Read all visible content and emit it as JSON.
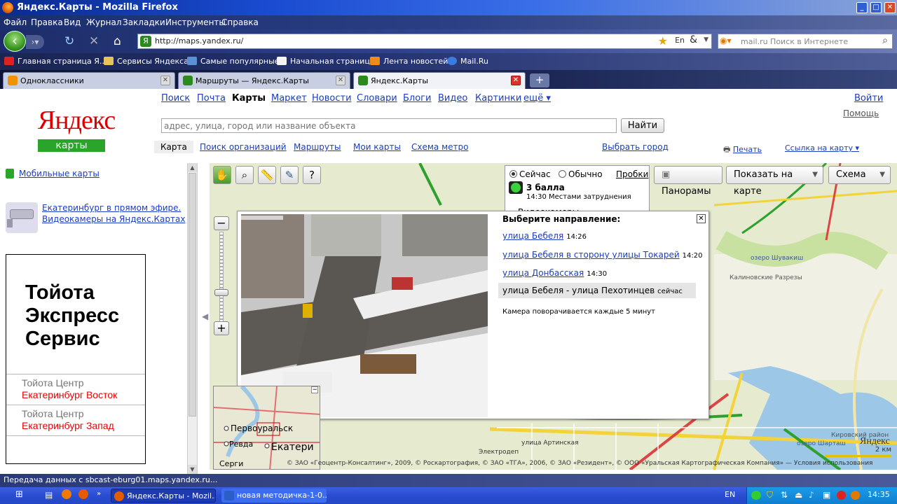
{
  "window": {
    "title": "Яндекс.Карты - Mozilla Firefox",
    "minimize": "_",
    "maximize": "□",
    "close": "✕"
  },
  "menu": [
    "Файл",
    "Правка",
    "Вид",
    "Журнал",
    "Закладки",
    "Инструменты",
    "Справка"
  ],
  "nav": {
    "url": "http://maps.yandex.ru/",
    "search_placeholder": "mail.ru Поиск в Интернете",
    "back_icon": "back-arrow-icon",
    "reload_icon": "reload-icon"
  },
  "bookmarks": [
    "Главная страница Я...",
    "Сервисы Яндекса",
    "Самые популярные",
    "Начальная страница",
    "Лента новостей",
    "Mail.Ru"
  ],
  "tabs": [
    {
      "label": "Одноклассники",
      "active": false
    },
    {
      "label": "Маршруты — Яндекс.Карты",
      "active": false
    },
    {
      "label": "Яндекс.Карты",
      "active": true
    }
  ],
  "header": {
    "logo": "Яндекс",
    "logo_sub": "карты",
    "services": [
      "Поиск",
      "Почта",
      "Карты",
      "Маркет",
      "Новости",
      "Словари",
      "Блоги",
      "Видео",
      "Картинки",
      "ещё ▾"
    ],
    "login": "Войти",
    "help": "Помощь",
    "search_placeholder": "адрес, улица, город или название объекта",
    "search_button": "Найти",
    "subtabs": [
      "Карта",
      "Поиск организаций",
      "Маршруты",
      "Мои карты",
      "Схема метро"
    ],
    "choose_city": "Выбрать город",
    "print": "Печать",
    "link_to_map": "Ссылка на карту ▾"
  },
  "sidebar": {
    "mobile": "Мобильные карты",
    "promo_line1": "Екатеринбург в прямом эфире.",
    "promo_line2": "Видеокамеры на Яндекс.Картах",
    "ad_big": [
      "Тойота",
      "Экспресс",
      "Сервис"
    ],
    "ad_rows": [
      {
        "a": "Тойота Центр",
        "b": "Екатеринбург Восток"
      },
      {
        "a": "Тойота Центр",
        "b": "Екатеринбург Запад"
      }
    ]
  },
  "map": {
    "panoramas": "Панорамы",
    "show_on_map": "Показать на карте",
    "scheme": "Схема",
    "traffic": {
      "now": "Сейчас",
      "usual": "Обычно",
      "jams": "Пробки",
      "score": "3 балла",
      "time_status": "14:30 Местами затруднения",
      "cameras": "Видеокамеры"
    },
    "popup": {
      "heading": "Выберите направление:",
      "streets": [
        {
          "name": "улица Бебеля",
          "time": "14:26"
        },
        {
          "name": "улица Бебеля в сторону улицы Токарей",
          "time": "14:20"
        },
        {
          "name": "улица Донбасская",
          "time": "14:30"
        },
        {
          "name": "улица Бебеля - улица Пехотинцев",
          "time": "сейчас"
        }
      ],
      "note": "Камера поворачивается каждые 5 минут"
    },
    "labels": [
      "Первоуральск",
      "Ревда",
      "Екатери",
      "Серги",
      "озеро Шувакиш",
      "Калиновские Разрезы",
      "озеро Шарташ",
      "Кировский район",
      "улица Артинская",
      "Электродеп"
    ],
    "copyright": "© ЗАО «Геоцентр-Консалтинг», 2009, © Роскартография, © ЗАО «ТГА», 2006, © ЗАО «Резидент», © ООО «Уральская Картографическая Компания» — Условия использования",
    "scale": "2 км",
    "watermark": "Яндекс"
  },
  "status": "Передача данных с sbcast-eburg01.maps.yandex.ru...",
  "taskbar": {
    "tasks": [
      "Яндекс.Карты - Mozil...",
      "новая методичка-1-0..."
    ],
    "lang": "EN",
    "clock": "14:35"
  }
}
